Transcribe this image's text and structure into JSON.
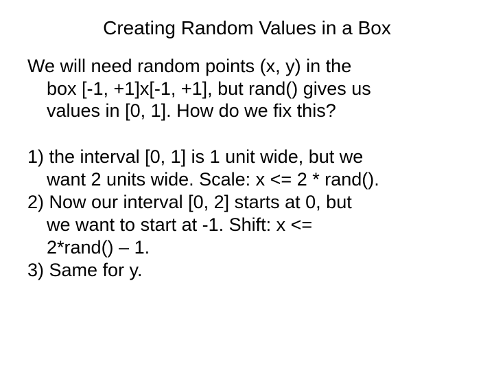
{
  "title": "Creating Random Values in a Box",
  "intro": {
    "l1": "We will need random points  (x, y) in the",
    "l2": "box  [-1, +1]x[-1, +1], but rand() gives us",
    "l3": "values in [0, 1].  How do we fix this?"
  },
  "items": {
    "i1": {
      "l1": "1) the interval [0, 1] is 1 unit wide, but we",
      "l2": "want 2 units wide.  Scale: x <= 2 * rand()."
    },
    "i2": {
      "l1": "2) Now our interval [0, 2] starts at 0, but",
      "l2": "we want to start at -1.  Shift: x <=",
      "l3": "2*rand() – 1."
    },
    "i3": {
      "l1": "3) Same for y."
    }
  }
}
